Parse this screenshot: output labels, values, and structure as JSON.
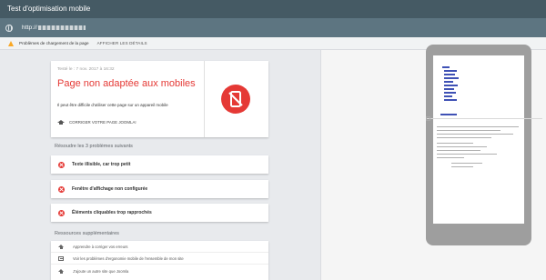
{
  "app": {
    "title": "Test d'optimisation mobile"
  },
  "url": {
    "prefix": "http://"
  },
  "warning": {
    "text": "Problèmes de chargement de la page",
    "details_label": "AFFICHER LES DÉTAILS"
  },
  "result": {
    "tested": "Testé le : 7 nov. 2017 à 16:32",
    "headline": "Page non adaptée aux mobiles",
    "description": "Il peut être difficile d'utiliser cette page sur un appareil mobile",
    "cta_label": "CORRIGER VOTRE PAGE JOOMLA!"
  },
  "issues": {
    "heading": "Résoudre les 3 problèmes suivants",
    "items": [
      {
        "label": "Texte illisible, car trop petit"
      },
      {
        "label": "Fenêtre d'affichage non configurée"
      },
      {
        "label": "Éléments cliquables trop rapprochés"
      }
    ]
  },
  "resources": {
    "heading": "Ressources supplémentaires",
    "items": [
      {
        "label": "Apprendre à corriger vos erreurs",
        "icon": "graduation-cap-icon"
      },
      {
        "label": "Voir les problèmes d'ergonomie mobile de l'ensemble de mon site",
        "icon": "document-icon"
      },
      {
        "label": "J'ajoute un autre site que Joomla",
        "icon": "graduation-cap-icon"
      }
    ]
  },
  "colors": {
    "header_bg": "#455a64",
    "urlbar_bg": "#5d7581",
    "error_red": "#e53935",
    "warning_yellow": "#f9a825",
    "phone_frame": "#9e9e9e"
  }
}
